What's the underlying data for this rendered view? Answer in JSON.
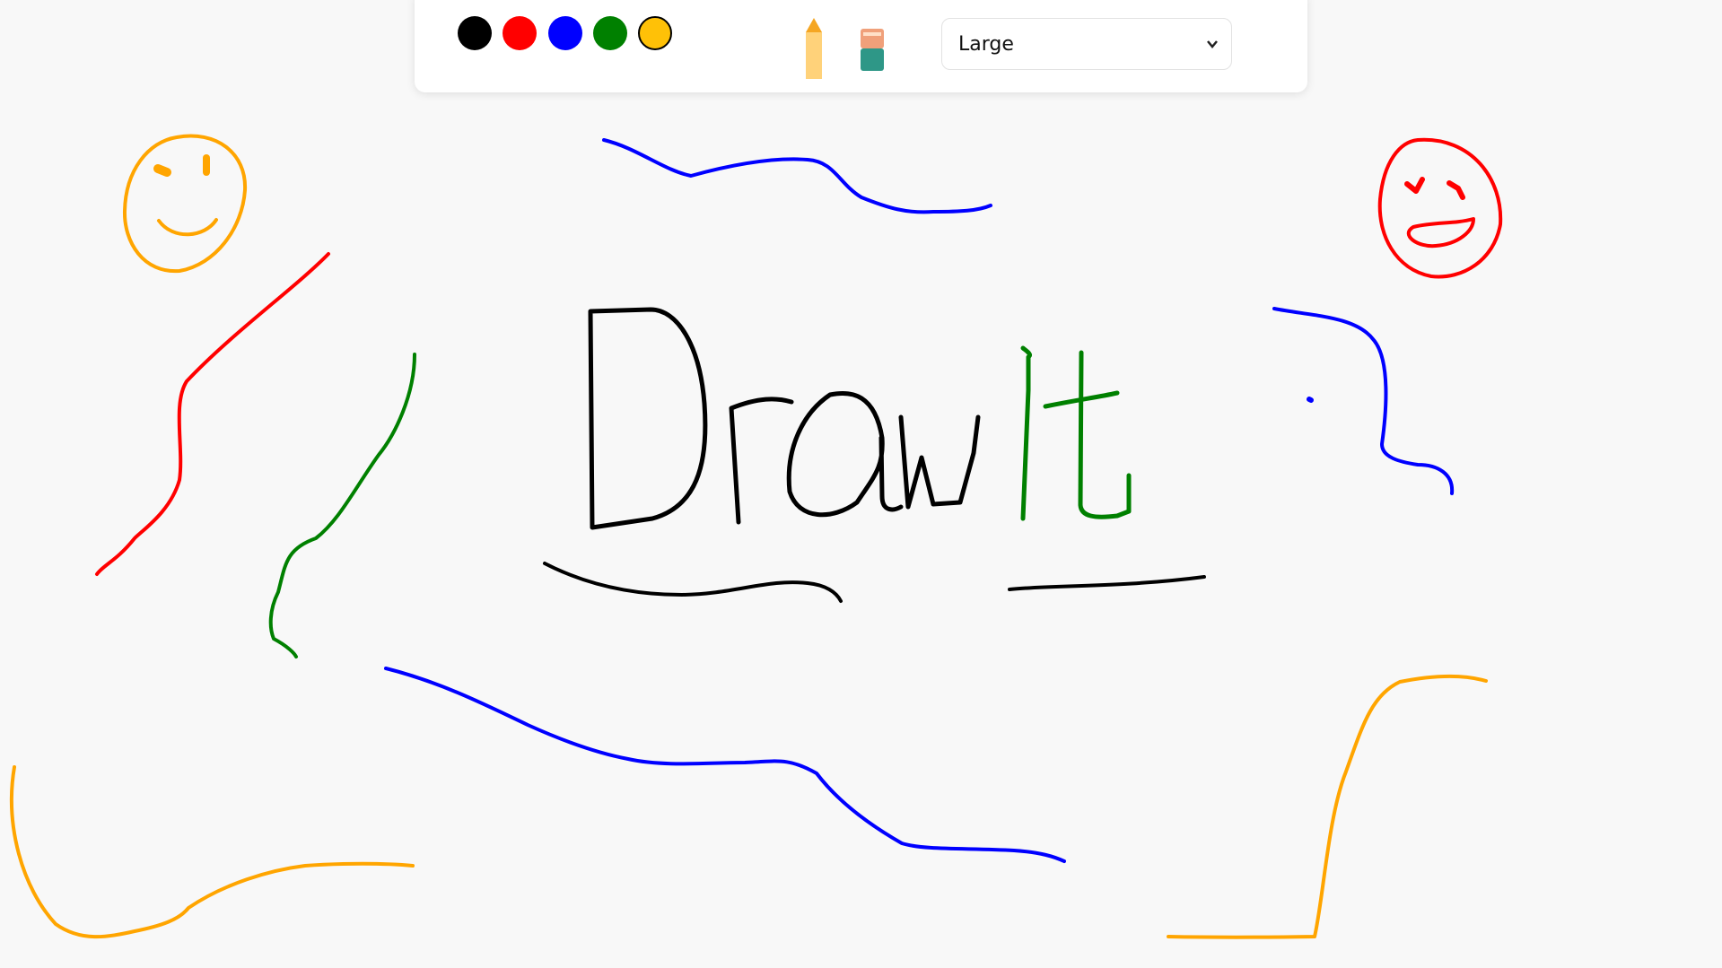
{
  "toolbar": {
    "colors": [
      {
        "name": "black",
        "hex": "#000000"
      },
      {
        "name": "red",
        "hex": "#ff0000"
      },
      {
        "name": "blue",
        "hex": "#0000ff"
      },
      {
        "name": "green",
        "hex": "#008000"
      },
      {
        "name": "yellow",
        "hex": "#ffc107",
        "selected": true
      }
    ],
    "tools": {
      "pencil": "pencil-icon",
      "eraser": "eraser-icon"
    },
    "brush_size": {
      "selected": "Large"
    }
  },
  "canvas": {
    "background": "#f8f8f8",
    "stroke_colors": {
      "black": "#000000",
      "red": "#ff0000",
      "blue": "#0000ff",
      "green": "#008000",
      "orange": "#ffa500"
    }
  }
}
